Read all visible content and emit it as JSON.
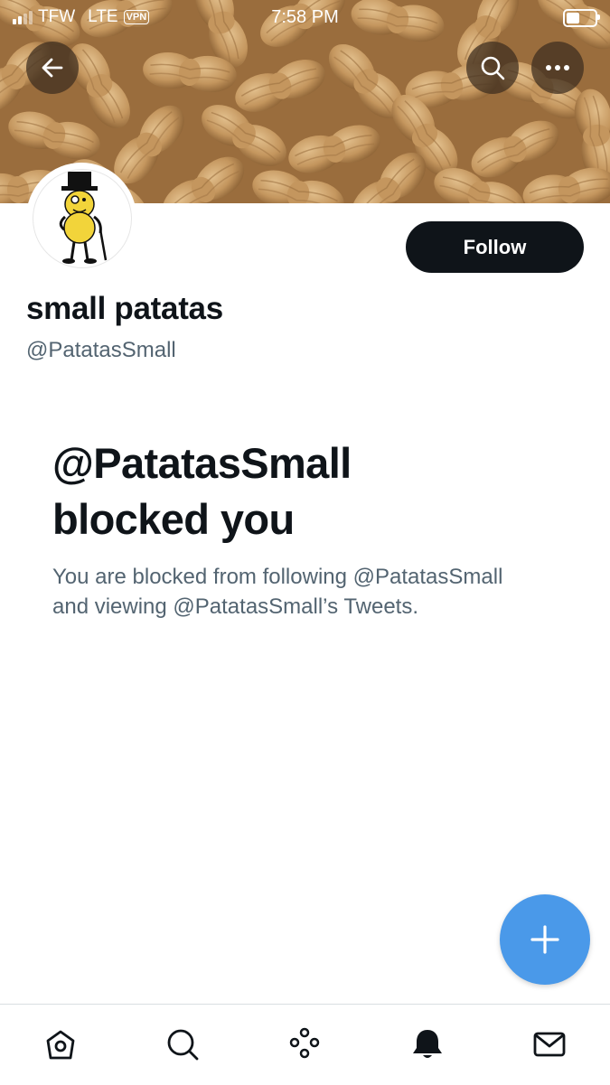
{
  "status_bar": {
    "carrier": "TFW",
    "network": "LTE",
    "vpn": "VPN",
    "time": "7:58 PM"
  },
  "header": {
    "back_icon": "arrow-left-icon",
    "search_icon": "search-icon",
    "more_icon": "ellipsis-icon",
    "banner_image": "peanuts"
  },
  "profile": {
    "display_name": "small patatas",
    "handle": "@PatatasSmall",
    "follow_label": "Follow",
    "avatar": "mr-peanut-mascot"
  },
  "blocked": {
    "title_line1": "@PatatasSmall",
    "title_line2": "blocked you",
    "desc_line1": "You are blocked from following @PatatasSmall",
    "desc_line2": "and viewing @PatatasSmall’s Tweets."
  },
  "fab": {
    "icon": "plus-icon"
  },
  "tabbar": {
    "items": [
      "home-icon",
      "search-icon",
      "spaces-icon",
      "notifications-icon",
      "messages-icon"
    ]
  },
  "colors": {
    "accent": "#4a99e9",
    "text": "#0f1419",
    "secondary": "#536471",
    "follow_button": "#0f1419"
  }
}
